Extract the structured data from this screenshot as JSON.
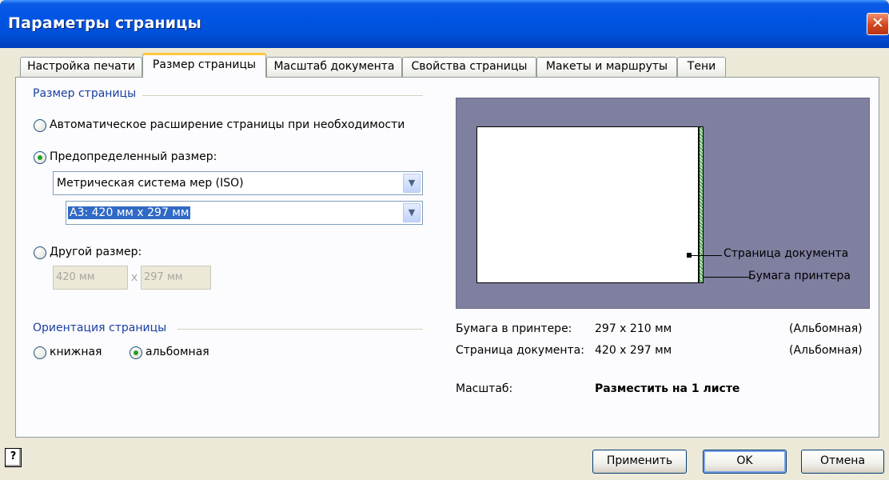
{
  "window": {
    "title": "Параметры страницы",
    "close": "✕"
  },
  "tabs": [
    {
      "label": "Настройка печати"
    },
    {
      "label": "Размер страницы"
    },
    {
      "label": "Масштаб документа"
    },
    {
      "label": "Свойства страницы"
    },
    {
      "label": "Макеты и маршруты"
    },
    {
      "label": "Тени"
    }
  ],
  "page_size": {
    "group_title": "Размер страницы",
    "auto_label": "Автоматическое расширение страницы при необходимости",
    "predefined_label": "Предопределенный размер:",
    "system_value": "Метрическая система мер (ISO)",
    "size_value": "A3:  420 мм x 297 мм",
    "custom_label": "Другой размер:",
    "width_value": "420 мм",
    "height_value": "297 мм",
    "x": "x",
    "selected": "predefined"
  },
  "orientation": {
    "group_title": "Ориентация страницы",
    "portrait": "книжная",
    "landscape": "альбомная",
    "selected": "landscape"
  },
  "preview": {
    "doc_page_callout": "Страница документа",
    "printer_paper_callout": "Бумага принтера"
  },
  "info": {
    "printer_paper_label": "Бумага в принтере:",
    "printer_paper_value": "297 x 210 мм",
    "printer_paper_orient": "(Альбомная)",
    "doc_page_label": "Страница документа:",
    "doc_page_value": "420 x 297 мм",
    "doc_page_orient": "(Альбомная)",
    "scale_label": "Масштаб:",
    "scale_value": "Разместить на 1 листе"
  },
  "buttons": {
    "apply": "Применить",
    "ok": "OK",
    "cancel": "Отмена",
    "help": "?"
  },
  "colors": {
    "titlebar": "#0054e3",
    "preview_bg": "#7f7fa0",
    "group_title": "#1a3ea0"
  }
}
